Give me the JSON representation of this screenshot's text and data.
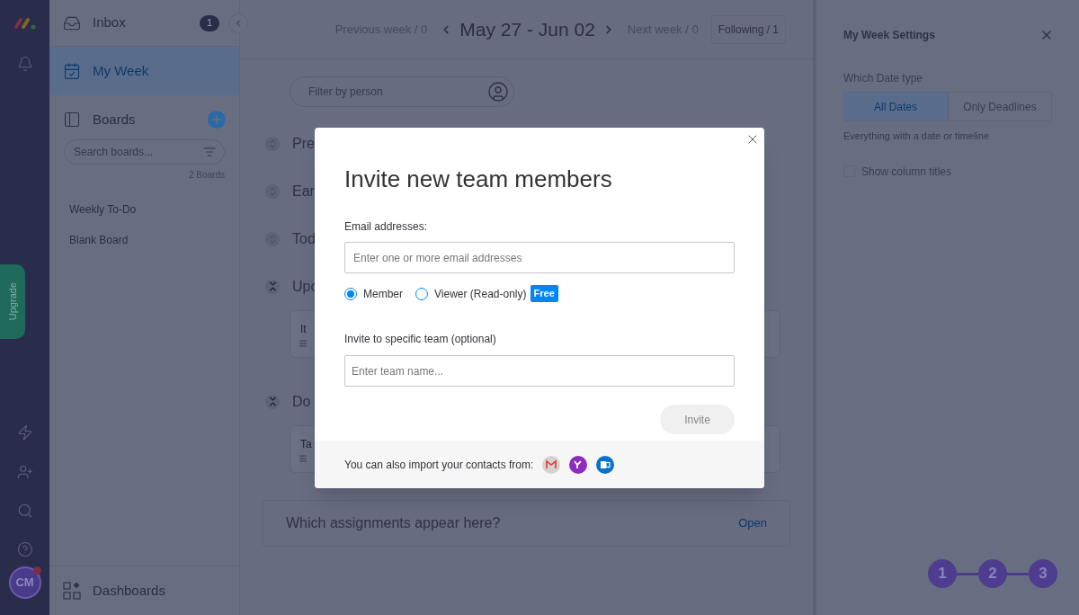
{
  "nav": {
    "upgrade": "Upgrade",
    "avatar": "CM",
    "avatar_dot": true
  },
  "sidebar": {
    "inbox": {
      "label": "Inbox",
      "count": "1"
    },
    "items": [
      {
        "label": "My Week",
        "selected": true
      }
    ],
    "boards": {
      "title": "Boards",
      "search_placeholder": "Search boards...",
      "count": "2 Boards",
      "list": [
        {
          "label": "Weekly To-Do",
          "selected": false
        },
        {
          "label": "Blank Board",
          "selected": false
        }
      ]
    },
    "dashboards": "Dashboards"
  },
  "week": {
    "previous": "Previous week / 0",
    "range": "May 27 - Jun 02",
    "next": "Next week / 0",
    "following": "Following / 1"
  },
  "filter": {
    "placeholder": "Filter by person"
  },
  "groups": [
    {
      "title": "Pre",
      "expanded": false
    },
    {
      "title": "Ear",
      "expanded": false
    },
    {
      "title": "Tod",
      "expanded": false
    },
    {
      "title": "Upc",
      "expanded": true,
      "cards": [
        "It"
      ]
    },
    {
      "title": "Do",
      "expanded": true,
      "cards": [
        "Ta"
      ]
    }
  ],
  "help": {
    "question": "Which assignments appear here?",
    "link": "Open"
  },
  "settings": {
    "title": "My Week Settings",
    "date_type_label": "Which Date type",
    "options": [
      {
        "label": "All Dates",
        "selected": true
      },
      {
        "label": "Only Deadlines",
        "selected": false
      }
    ],
    "hint": "Everything with a date or timeline",
    "show_column_titles": {
      "label": "Show column titles",
      "checked": false
    },
    "steps": [
      "1",
      "2",
      "3"
    ]
  },
  "modal": {
    "title": "Invite new team members",
    "email_label": "Email addresses:",
    "email_placeholder": "Enter one or more email addresses",
    "roles": [
      {
        "label": "Member",
        "selected": true
      },
      {
        "label": "Viewer (Read-only)",
        "selected": false,
        "badge": "Free"
      }
    ],
    "team_label": "Invite to specific team (optional)",
    "team_placeholder": "Enter team name...",
    "invite": "Invite",
    "import_text": "You can also import your contacts from:"
  }
}
